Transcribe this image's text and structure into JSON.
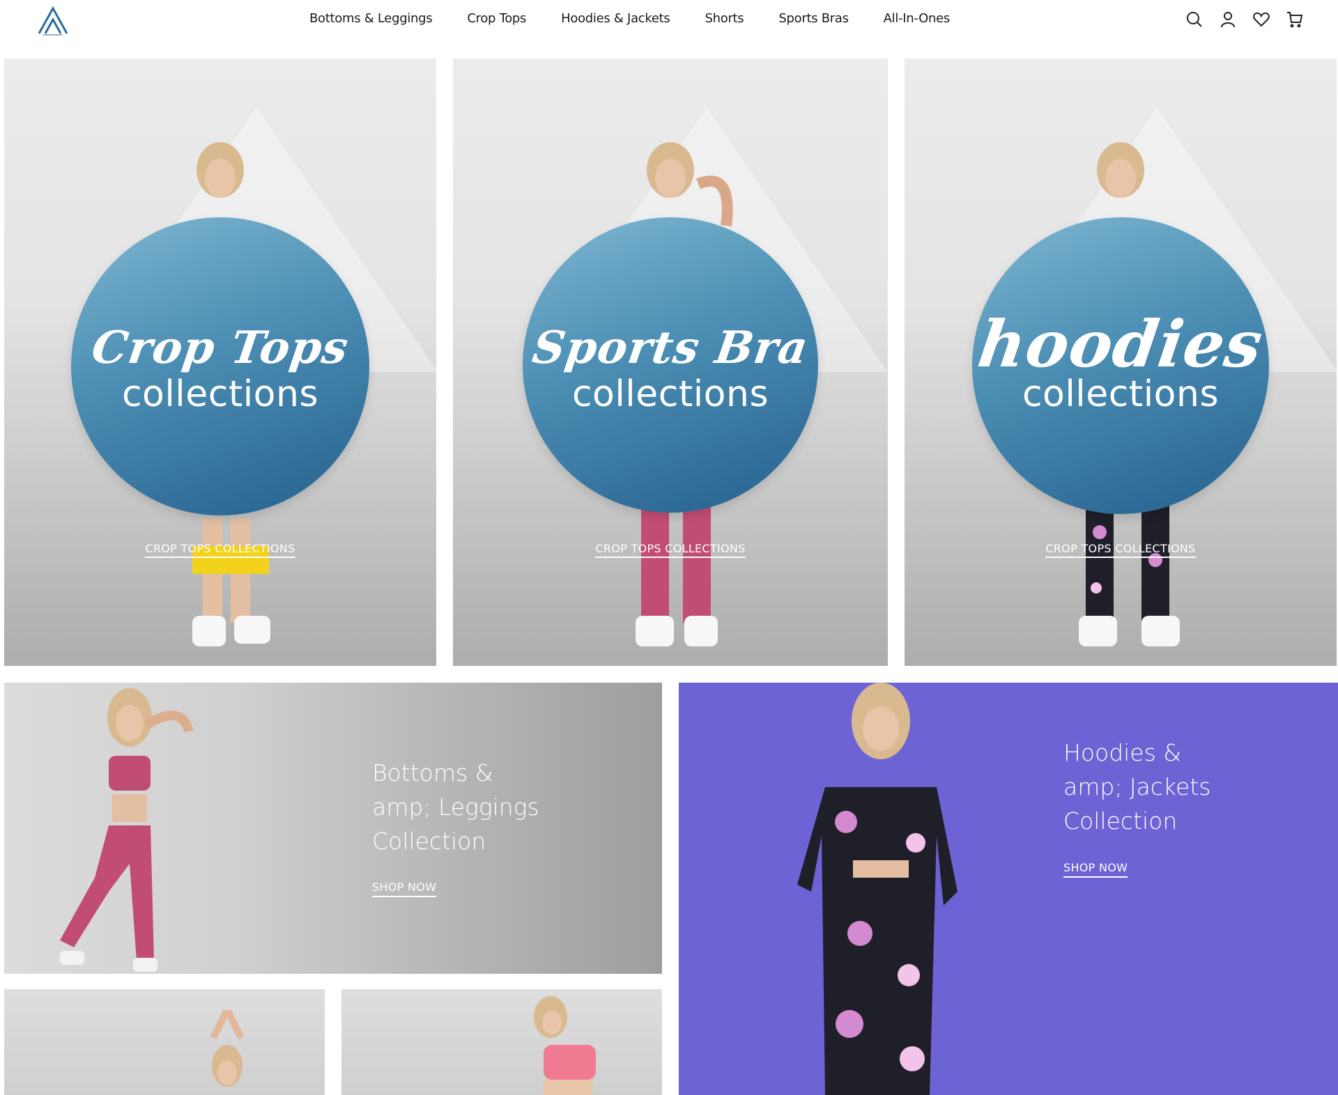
{
  "header": {
    "nav": [
      {
        "label": "Bottoms & Leggings"
      },
      {
        "label": "Crop Tops"
      },
      {
        "label": "Hoodies & Jackets"
      },
      {
        "label": "Shorts"
      },
      {
        "label": "Sports Bras"
      },
      {
        "label": "All-In-Ones"
      }
    ],
    "icons": [
      "search-icon",
      "account-icon",
      "wishlist-icon",
      "cart-icon"
    ]
  },
  "panels": [
    {
      "script": "Crop Tops",
      "sub": "collections",
      "cta": "CROP TOPS COLLECTIONS",
      "legging_color": "#f2d21a"
    },
    {
      "script": "Sports Bra",
      "sub": "collections",
      "cta": "CROP TOPS COLLECTIONS",
      "legging_color": "#c24d72"
    },
    {
      "script": "hoodies",
      "sub": "collections",
      "cta": "CROP TOPS COLLECTIONS",
      "legging_color": "#1f1f2a"
    }
  ],
  "banners": {
    "bottoms": {
      "lines": [
        "Bottoms &",
        "amp; Leggings",
        "Collection"
      ],
      "cta": "SHOP NOW"
    },
    "hoodies": {
      "lines": [
        "Hoodies &",
        "amp; Jackets",
        "Collection"
      ],
      "cta": "SHOP NOW",
      "bg": "#6d63d4"
    }
  },
  "colors": {
    "circle": "#3f82ad",
    "accent_purple": "#6d63d4"
  }
}
